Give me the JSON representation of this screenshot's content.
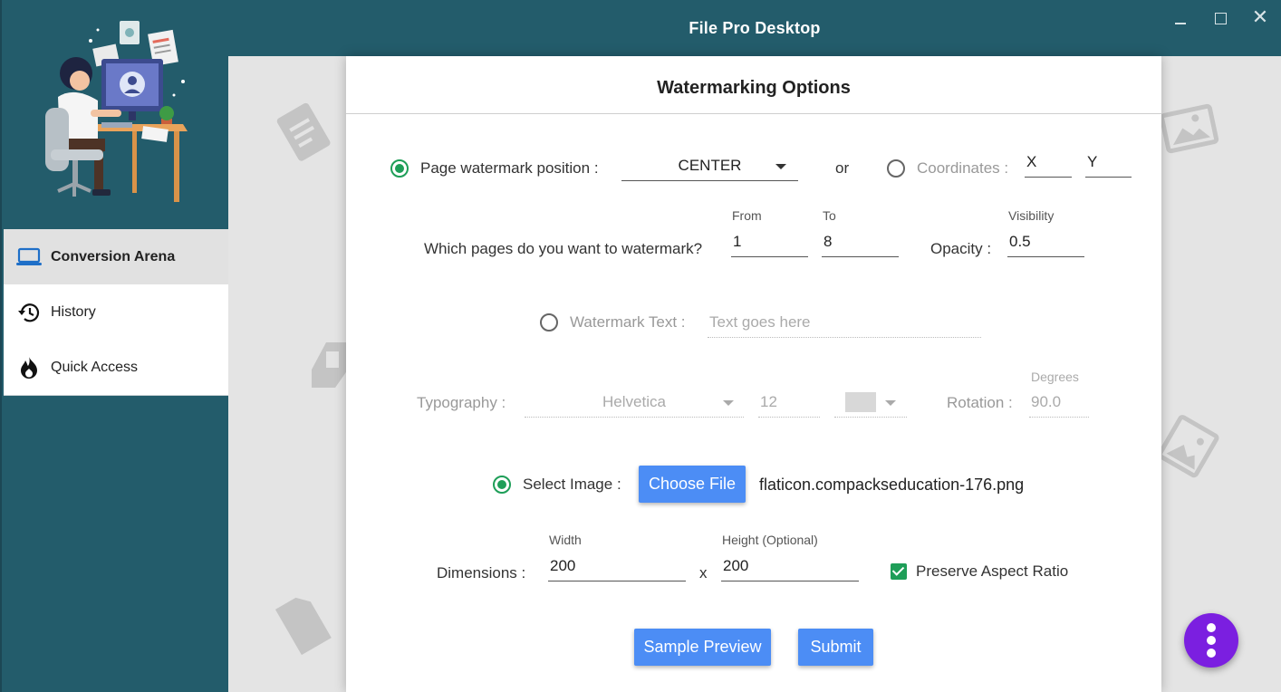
{
  "window": {
    "title": "File Pro Desktop",
    "controls": {
      "minimize_icon": "minimize-icon",
      "maximize_icon": "maximize-icon",
      "close": "✕"
    }
  },
  "sidebar": {
    "items": [
      {
        "label": "Conversion Arena",
        "icon": "laptop-icon",
        "active": true
      },
      {
        "label": "History",
        "icon": "history-icon",
        "active": false
      },
      {
        "label": "Quick Access",
        "icon": "flame-icon",
        "active": false
      }
    ]
  },
  "card": {
    "title": "Watermarking Options",
    "position": {
      "label": "Page watermark position :",
      "value": "CENTER",
      "or_text": "or",
      "coordinates_label": "Coordinates :",
      "x_value": "X",
      "y_value": "Y"
    },
    "pages": {
      "label": "Which pages do you want to watermark?",
      "from_label": "From",
      "from_value": "1",
      "to_label": "To",
      "to_value": "8"
    },
    "opacity": {
      "label": "Opacity :",
      "visibility_label": "Visibility",
      "value": "0.5"
    },
    "text_watermark": {
      "label": "Watermark Text :",
      "placeholder": "Text goes here"
    },
    "typography": {
      "label": "Typography :",
      "font": "Helvetica",
      "size": "12",
      "rotation_label": "Rotation :",
      "degrees_label": "Degrees",
      "rotation_value": "90.0"
    },
    "image": {
      "label": "Select Image :",
      "button": "Choose File",
      "filename": "flaticon.compackseducation-176.png"
    },
    "dimensions": {
      "label": "Dimensions :",
      "width_label": "Width",
      "width_value": "200",
      "times": "x",
      "height_label": "Height (Optional)",
      "height_value": "200",
      "preserve_label": "Preserve Aspect Ratio"
    },
    "buttons": {
      "preview": "Sample Preview",
      "submit": "Submit"
    }
  },
  "colors": {
    "sidebar_bg": "#235c6b",
    "accent_green": "#1e9e58",
    "button_blue": "#4c8df5",
    "fab_purple": "#7b1fe0"
  }
}
